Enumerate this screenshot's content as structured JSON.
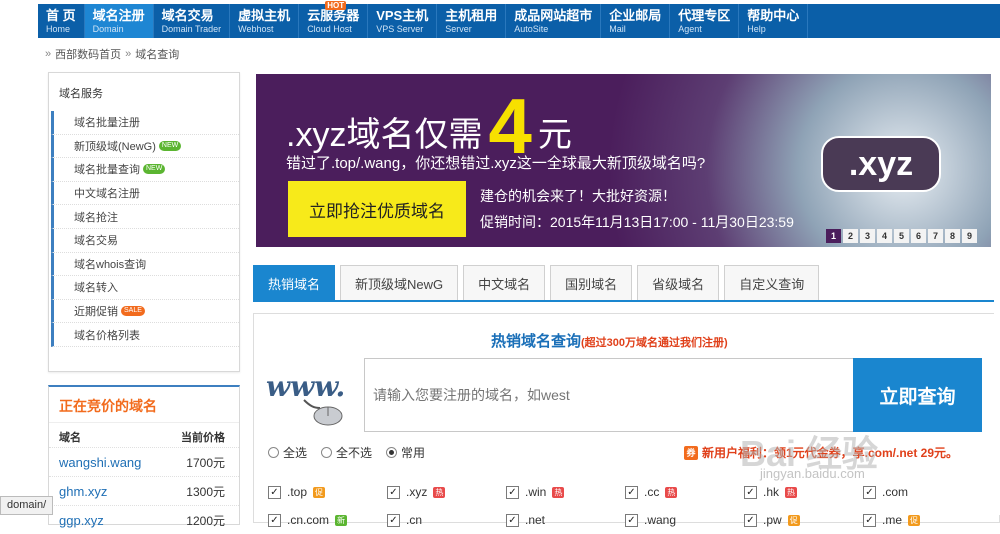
{
  "nav": {
    "items": [
      {
        "cn": "首 页",
        "en": "Home"
      },
      {
        "cn": "域名注册",
        "en": "Domain"
      },
      {
        "cn": "域名交易",
        "en": "Domain Trader"
      },
      {
        "cn": "虚拟主机",
        "en": "Webhost"
      },
      {
        "cn": "云服务器",
        "en": "Cloud Host",
        "badge": "HOT"
      },
      {
        "cn": "VPS主机",
        "en": "VPS Server"
      },
      {
        "cn": "主机租用",
        "en": "Server"
      },
      {
        "cn": "成品网站超市",
        "en": "AutoSite"
      },
      {
        "cn": "企业邮局",
        "en": "Mail"
      },
      {
        "cn": "代理专区",
        "en": "Agent"
      },
      {
        "cn": "帮助中心",
        "en": "Help"
      }
    ],
    "active_index": 1,
    "colors": {
      "bar": "#0b5fa8",
      "active": "#1e86d3"
    }
  },
  "breadcrumb": {
    "home": "西部数码首页",
    "current": "域名查询"
  },
  "sidebar": {
    "title": "域名服务",
    "items": [
      {
        "label": "域名批量注册"
      },
      {
        "label": "新顶级域(NewG)",
        "tag": "NEW"
      },
      {
        "label": "域名批量查询",
        "tag": "NEW"
      },
      {
        "label": "中文域名注册"
      },
      {
        "label": "域名抢注"
      },
      {
        "label": "域名交易"
      },
      {
        "label": "域名whois查询"
      },
      {
        "label": "域名转入"
      },
      {
        "label": "近期促销",
        "tag": "SALE"
      },
      {
        "label": "域名价格列表"
      }
    ]
  },
  "auction": {
    "title": "正在竞价的域名",
    "col_domain": "域名",
    "col_price": "当前价格",
    "rows": [
      {
        "domain": "wangshi.wang",
        "price": "1700元"
      },
      {
        "domain": "ghm.xyz",
        "price": "1300元"
      },
      {
        "domain": "ggp.xyz",
        "price": "1200元"
      }
    ]
  },
  "status_tooltip": "domain/",
  "banner": {
    "headline_pre": ".xyz域名仅需",
    "headline_num": "4",
    "headline_post": "元",
    "subtitle": "错过了.top/.wang，你还想错过.xyz这一全球最大新顶级域名吗?",
    "cta": "立即抢注优质域名",
    "line1": "建仓的机会来了！大批好资源！",
    "line2": "促销时间：2015年11月13日17:00 - 11月30日23:59",
    "logo": ".xyz",
    "slides": [
      "1",
      "2",
      "3",
      "4",
      "5",
      "6",
      "7",
      "8",
      "9"
    ],
    "active_slide": 0,
    "accent": "#f7e000"
  },
  "tabs": [
    {
      "label": "热销域名"
    },
    {
      "label": "新顶级域NewG"
    },
    {
      "label": "中文域名"
    },
    {
      "label": "国别域名"
    },
    {
      "label": "省级域名"
    },
    {
      "label": "自定义查询"
    }
  ],
  "search": {
    "title": "热销域名查询",
    "note": "(超过300万域名通过我们注册)",
    "placeholder": "请输入您要注册的域名，如west",
    "button": "立即查询",
    "radio_all": "全选",
    "radio_none": "全不选",
    "radio_common": "常用",
    "radio_selected": "常用",
    "promo_icon": "券",
    "promo": "新用户福利：领1元代金券，享.com/.net 29元。"
  },
  "tlds": [
    [
      {
        "name": ".top",
        "badge": "促",
        "badge_type": "promo",
        "checked": true
      },
      {
        "name": ".xyz",
        "badge": "热",
        "badge_type": "hot",
        "checked": true
      },
      {
        "name": ".win",
        "badge": "热",
        "badge_type": "hot",
        "checked": true
      },
      {
        "name": ".cc",
        "badge": "热",
        "badge_type": "hot",
        "checked": true
      },
      {
        "name": ".hk",
        "badge": "热",
        "badge_type": "hot",
        "checked": true
      },
      {
        "name": ".com",
        "checked": true
      }
    ],
    [
      {
        "name": ".cn.com",
        "badge": "新",
        "badge_type": "new",
        "checked": true
      },
      {
        "name": ".cn",
        "checked": true
      },
      {
        "name": ".net",
        "checked": true
      },
      {
        "name": ".wang",
        "checked": true
      },
      {
        "name": ".pw",
        "badge": "促",
        "badge_type": "promo",
        "checked": true
      },
      {
        "name": ".me",
        "badge": "促",
        "badge_type": "promo",
        "checked": true
      }
    ]
  ],
  "watermark": {
    "main": "Bai 经验",
    "sub": "jingyan.baidu.com"
  }
}
